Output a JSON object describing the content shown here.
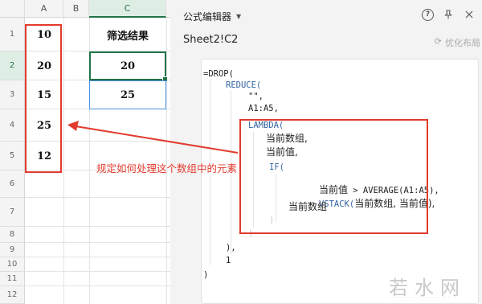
{
  "sheet": {
    "columns": [
      "A",
      "B",
      "C"
    ],
    "rows": [
      "1",
      "2",
      "3",
      "4",
      "5",
      "6",
      "7",
      "8",
      "9",
      "10",
      "11",
      "12"
    ],
    "colA": [
      "10",
      "20",
      "15",
      "25",
      "12"
    ],
    "colC_header": "筛选结果",
    "colC": [
      "20",
      "25"
    ]
  },
  "panel": {
    "title": "公式编辑器",
    "cell_ref": "Sheet2!C2",
    "optimize_label": "优化布局",
    "help_icon": "help-icon",
    "pin_icon": "pin-icon",
    "close_icon": "close-icon"
  },
  "formula": {
    "l1": "=DROP(",
    "l2": "REDUCE(",
    "l3": "\"\",",
    "l4": "A1:A5,",
    "l5": "LAMBDA(",
    "l6": "当前数组,",
    "l7": "当前值,",
    "l8": "IF(",
    "l9a": "当前值",
    "l9b": " > AVERAGE(A1:A5),",
    "l10a": "VSTACK(",
    "l10b": "当前数组, 当前值),",
    "l11": "当前数组",
    "l12": ")",
    "l13": ")",
    "l14": "),",
    "l15": "1",
    "l16": ")"
  },
  "annotation": "规定如何处理这个数组中的元素",
  "watermark": "若水网",
  "colors": {
    "accent_green": "#217346",
    "annotation_red": "#e23b2e",
    "code_blue": "#3465a4"
  }
}
